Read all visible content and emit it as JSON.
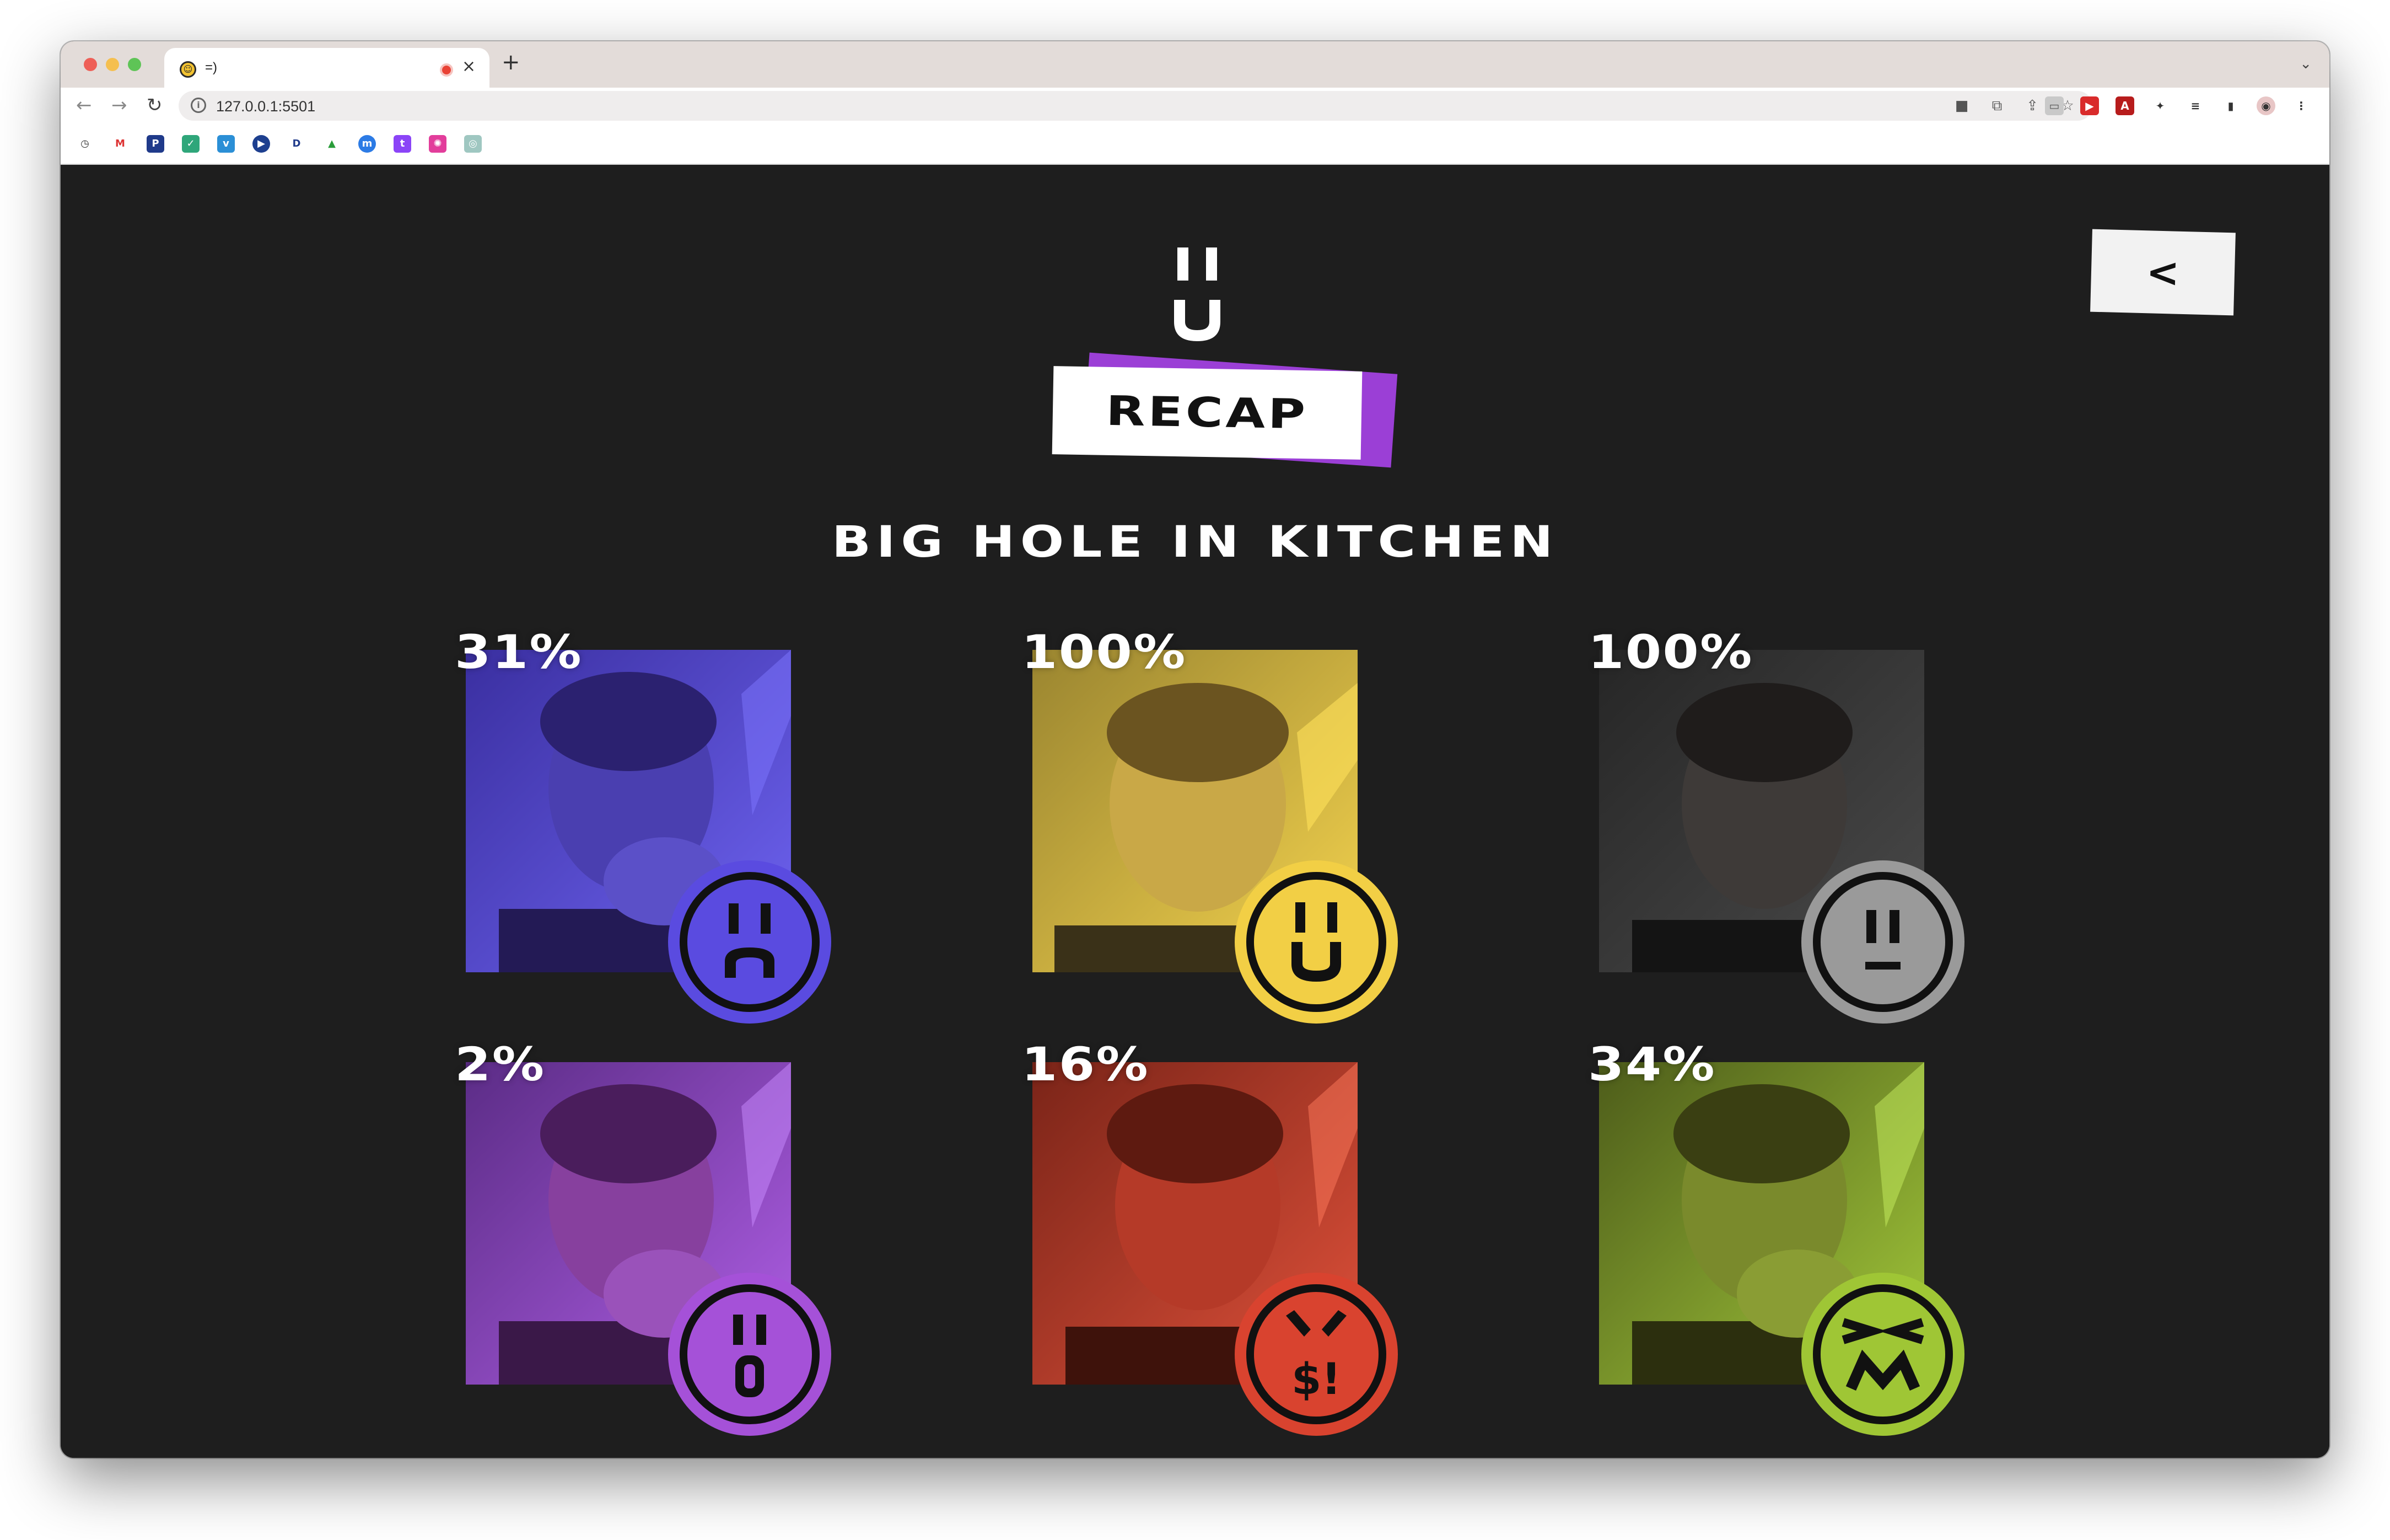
{
  "browser": {
    "tab_title": "=)",
    "tab_favicon": "smiley-favicon-icon",
    "url": "127.0.0.1:5501",
    "new_tab_label": "+",
    "close_tab_label": "×"
  },
  "header": {
    "logo": "smiley-logo-icon",
    "recap_label": "RECAP",
    "topic": "BIG HOLE IN KITCHEN",
    "back_label": "<"
  },
  "colors": {
    "background": "#1e1e1e",
    "recap_accent": "#9b3fd6",
    "blue": "#5a4be0",
    "yellow": "#f2cf45",
    "gray": "#9a9a9a",
    "purple": "#a551d8",
    "red": "#d9432f",
    "green": "#9fc635"
  },
  "emotions": [
    {
      "percent": "31%",
      "emotion": "sad",
      "color": "#5a4be0",
      "icon": "sad-face-icon"
    },
    {
      "percent": "100%",
      "emotion": "happy",
      "color": "#f2cf45",
      "icon": "happy-face-icon"
    },
    {
      "percent": "100%",
      "emotion": "neutral",
      "color": "#9a9a9a",
      "icon": "neutral-face-icon"
    },
    {
      "percent": "2%",
      "emotion": "surprised",
      "color": "#a551d8",
      "icon": "surprised-face-icon"
    },
    {
      "percent": "16%",
      "emotion": "angry",
      "color": "#d9432f",
      "icon": "angry-face-icon",
      "mouth_text": "$!"
    },
    {
      "percent": "34%",
      "emotion": "disgusted",
      "color": "#9fc635",
      "icon": "disgusted-face-icon"
    }
  ]
}
